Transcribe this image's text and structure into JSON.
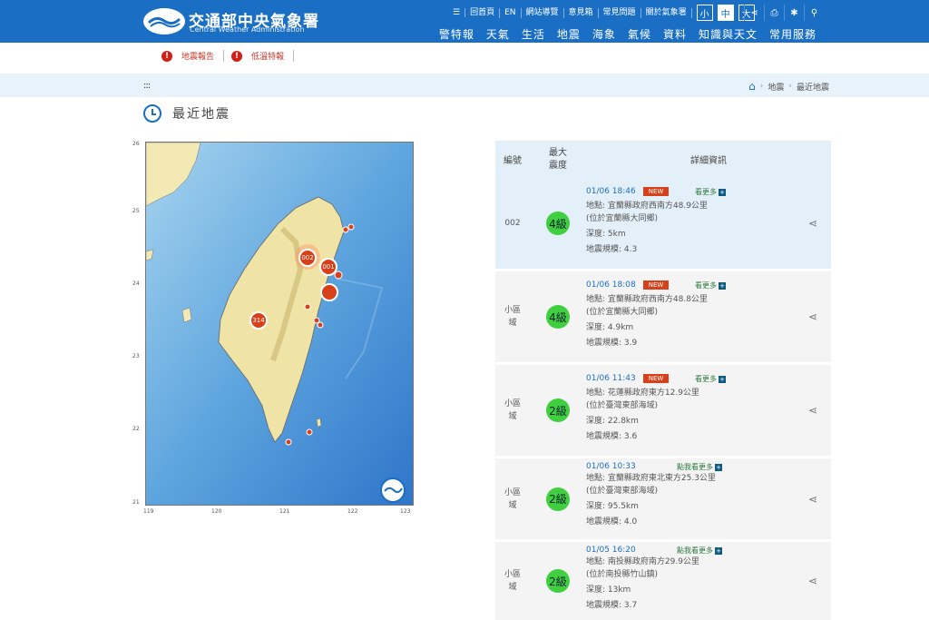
{
  "header": {
    "title": "交通部中央氣象署",
    "subtitle": "Central Weather Administration",
    "top_links": [
      "回首頁",
      "EN",
      "網站導覽",
      "意見箱",
      "常見問題",
      "關於氣象署"
    ],
    "size_buttons": [
      "小",
      "中",
      "大"
    ],
    "active_size": "中",
    "nav": [
      "警特報",
      "天氣",
      "生活",
      "地震",
      "海象",
      "氣候",
      "資料",
      "知識與天文",
      "常用服務"
    ]
  },
  "alerts": [
    "地震報告",
    "低溫特報"
  ],
  "breadcrumb": {
    "dots": ":::",
    "items": [
      "地震",
      "最近地震"
    ]
  },
  "page_title": "最近地震",
  "map": {
    "y_ticks": [
      "26",
      "25",
      "24",
      "23",
      "22",
      "21"
    ],
    "x_ticks": [
      "119",
      "120",
      "121",
      "122",
      "123"
    ],
    "markers": [
      {
        "label": "002"
      },
      {
        "label": "001"
      },
      {
        "label": "314"
      }
    ]
  },
  "table": {
    "headers": {
      "no": "編號",
      "intensity": "最大震度",
      "detail": "詳細資訊"
    },
    "rows": [
      {
        "no": "002",
        "level": "4級",
        "time": "01/06 18:46",
        "new": "NEW",
        "more": "看更多",
        "location": "地點: 宜蘭縣政府西南方48.9公里",
        "region": "(位於宜蘭縣大同鄉)",
        "depth": "深度: 5km",
        "magnitude": "地震規模: 4.3"
      },
      {
        "no": "小區域",
        "level": "4級",
        "time": "01/06 18:08",
        "new": "NEW",
        "more": "看更多",
        "location": "地點: 宜蘭縣政府西南方48.8公里",
        "region": "(位於宜蘭縣大同鄉)",
        "depth": "深度: 4.9km",
        "magnitude": "地震規模: 3.9"
      },
      {
        "no": "小區域",
        "level": "2級",
        "time": "01/06 11:43",
        "new": "NEW",
        "more": "看更多",
        "location": "地點: 花蓮縣政府東方12.9公里",
        "region": "(位於臺灣東部海域)",
        "depth": "深度: 22.8km",
        "magnitude": "地震規模: 3.6"
      },
      {
        "no": "小區域",
        "level": "2級",
        "time": "01/06 10:33",
        "new": "",
        "more": "點我看更多",
        "location": "地點: 宜蘭縣政府東北東方25.3公里",
        "region": "(位於臺灣東部海域)",
        "depth": "深度: 95.5km",
        "magnitude": "地震規模: 4.0"
      },
      {
        "no": "小區域",
        "level": "2級",
        "time": "01/05 16:20",
        "new": "",
        "more": "點我看更多",
        "location": "地點: 南投縣政府南方29.9公里",
        "region": "(位於南投縣竹山鎮)",
        "depth": "深度: 13km",
        "magnitude": "地震規模: 3.7"
      }
    ]
  },
  "colors": {
    "header": "#1a6fc4",
    "level_green": "#3fcf3f",
    "new_badge": "#d8401a"
  }
}
